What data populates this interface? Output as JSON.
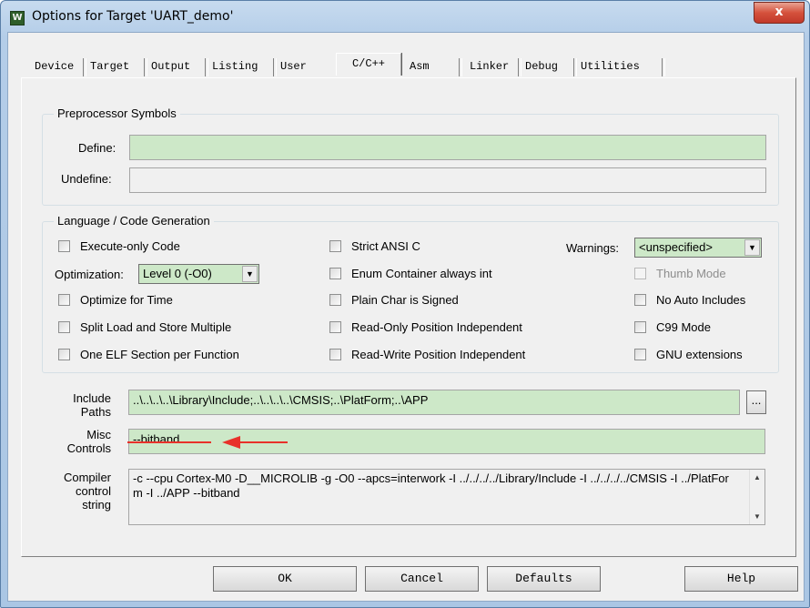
{
  "window": {
    "title": "Options for Target 'UART_demo'",
    "close_label": "x",
    "app_icon_glyph": "W"
  },
  "tabs": [
    {
      "label": "Device"
    },
    {
      "label": "Target"
    },
    {
      "label": "Output"
    },
    {
      "label": "Listing"
    },
    {
      "label": "User"
    },
    {
      "label": "C/C++",
      "active": true
    },
    {
      "label": "Asm"
    },
    {
      "label": "Linker"
    },
    {
      "label": "Debug"
    },
    {
      "label": "Utilities"
    }
  ],
  "preprocessor": {
    "legend": "Preprocessor Symbols",
    "define_label": "Define:",
    "define_value": "",
    "undefine_label": "Undefine:",
    "undefine_value": ""
  },
  "language": {
    "legend": "Language / Code Generation",
    "execute_only": "Execute-only Code",
    "optimization_label": "Optimization:",
    "optimization_value": "Level 0 (-O0)",
    "optimize_time": "Optimize for Time",
    "split_load": "Split Load and Store Multiple",
    "one_elf": "One ELF Section per Function",
    "strict_ansi": "Strict ANSI C",
    "enum_container": "Enum Container always int",
    "plain_char": "Plain Char is Signed",
    "ro_pi": "Read-Only Position Independent",
    "rw_pi": "Read-Write Position Independent",
    "warnings_label": "Warnings:",
    "warnings_value": "<unspecified>",
    "thumb_mode": "Thumb Mode",
    "no_auto_includes": "No Auto Includes",
    "c99_mode": "C99 Mode",
    "gnu_ext": "GNU extensions"
  },
  "include": {
    "label_line1": "Include",
    "label_line2": "Paths",
    "value": "..\\..\\..\\..\\Library\\Include;..\\..\\..\\..\\CMSIS;..\\PlatForm;..\\APP",
    "browse_label": "..."
  },
  "misc": {
    "label_line1": "Misc",
    "label_line2": "Controls",
    "value": "--bitband"
  },
  "compiler": {
    "label_line1": "Compiler",
    "label_line2": "control",
    "label_line3": "string",
    "value": "-c --cpu Cortex-M0 -D__MICROLIB -g -O0 --apcs=interwork -I ../../../../Library/Include -I ../../../../CMSIS -I ../PlatForm -I ../APP --bitband"
  },
  "buttons": {
    "ok": "OK",
    "cancel": "Cancel",
    "defaults": "Defaults",
    "help": "Help"
  },
  "colors": {
    "annotation_arrow": "#e8312a",
    "field_green": "#cde8c8"
  },
  "icons": {
    "dropdown": "chevron-down-icon",
    "scroll_up": "scroll-up-icon",
    "scroll_down": "scroll-down-icon",
    "annotation": "red-arrow-icon"
  }
}
